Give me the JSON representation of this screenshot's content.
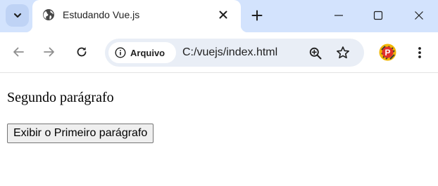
{
  "browser": {
    "tab": {
      "title": "Estudando Vue.js"
    },
    "address_bar": {
      "site_info_label": "Arquivo",
      "url": "C:/vuejs/index.html"
    },
    "extension": {
      "badge_letter": "P"
    },
    "colors": {
      "tabstrip_bg": "#d3e3fd",
      "omnibox_bg": "#e9eef6",
      "icon": "#1f1f1f",
      "icon_disabled": "#8e8e8e",
      "extension_badge": "#e0312a",
      "extension_ring": "#f2b705"
    }
  },
  "page": {
    "paragraph_text": "Segundo parágrafo",
    "toggle_button_label": "Exibir o Primeiro parágrafo"
  }
}
